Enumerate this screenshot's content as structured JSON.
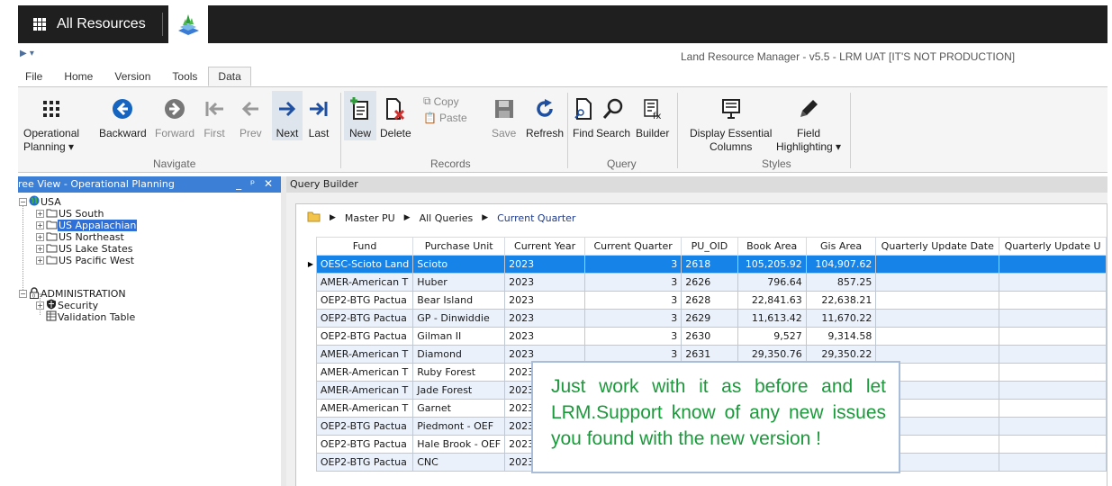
{
  "topbar": {
    "waffle_icon": "app-launcher-icon",
    "title": "All Resources",
    "logo_icon": "lrm-logo-icon"
  },
  "window": {
    "title": "Land Resource Manager - v5.5 - LRM UAT [IT'S NOT PRODUCTION]"
  },
  "menu": {
    "tabs": [
      "File",
      "Home",
      "Version",
      "Tools",
      "Data"
    ],
    "active": "Data"
  },
  "ribbon": {
    "operational_planning": [
      "Operational",
      "Planning ▾"
    ],
    "backward": "Backward",
    "forward": "Forward",
    "first": "First",
    "prev": "Prev",
    "next": "Next",
    "last": "Last",
    "navigate_group": "Navigate",
    "new": "New",
    "delete": "Delete",
    "copy": "Copy",
    "paste": "Paste",
    "save": "Save",
    "refresh": "Refresh",
    "records_group": "Records",
    "find": "Find",
    "search": "Search",
    "builder": "Builder",
    "query_group": "Query",
    "display_essential": [
      "Display Essential",
      "Columns"
    ],
    "field_highlighting": [
      "Field",
      "Highlighting ▾"
    ],
    "styles_group": "Styles"
  },
  "tree": {
    "header": "ree View - Operational Planning",
    "header_controls": "_ ᵖ ✕",
    "nodes": {
      "usa": "USA",
      "us_south": "US South",
      "us_appalachian": "US Appalachian",
      "us_northeast": "US Northeast",
      "us_lake_states": "US Lake States",
      "us_pacific_west": "US Pacific West",
      "administration": "ADMINISTRATION",
      "security": "Security",
      "validation_table": "Validation Table"
    }
  },
  "query": {
    "header": "Query Builder",
    "breadcrumb": [
      "Master PU",
      "All Queries",
      "Current Quarter"
    ],
    "columns": [
      "Fund",
      "Purchase Unit",
      "Current Year",
      "Current Quarter",
      "PU_OID",
      "Book Area",
      "Gis Area",
      "Quarterly Update Date",
      "Quarterly Update U"
    ],
    "rows": [
      [
        "OESC-Scioto Land",
        "Scioto",
        "2023",
        "3",
        "2618",
        "105,205.92",
        "104,907.62",
        "",
        ""
      ],
      [
        "AMER-American T",
        "Huber",
        "2023",
        "3",
        "2626",
        "796.64",
        "857.25",
        "",
        ""
      ],
      [
        "OEP2-BTG Pactua",
        "Bear Island",
        "2023",
        "3",
        "2628",
        "22,841.63",
        "22,638.21",
        "",
        ""
      ],
      [
        "OEP2-BTG Pactua",
        "GP - Dinwiddie",
        "2023",
        "3",
        "2629",
        "11,613.42",
        "11,670.22",
        "",
        ""
      ],
      [
        "OEP2-BTG Pactua",
        "Gilman II",
        "2023",
        "3",
        "2630",
        "9,527",
        "9,314.58",
        "",
        ""
      ],
      [
        "AMER-American T",
        "Diamond",
        "2023",
        "3",
        "2631",
        "29,350.76",
        "29,350.22",
        "",
        ""
      ],
      [
        "AMER-American T",
        "Ruby Forest",
        "2023",
        "",
        "",
        "",
        "",
        "",
        ""
      ],
      [
        "AMER-American T",
        "Jade Forest",
        "2023",
        "",
        "",
        "",
        "",
        "",
        ""
      ],
      [
        "AMER-American T",
        "Garnet",
        "2023",
        "",
        "",
        "",
        "",
        "",
        ""
      ],
      [
        "OEP2-BTG Pactua",
        "Piedmont - OEF",
        "2023",
        "",
        "",
        "",
        "",
        "",
        ""
      ],
      [
        "OEP2-BTG Pactua",
        "Hale Brook - OEF",
        "2023",
        "",
        "",
        "",
        "",
        "",
        ""
      ],
      [
        "OEP2-BTG Pactua",
        "CNC",
        "2023",
        "",
        "",
        "",
        "",
        "",
        ""
      ]
    ],
    "selected_row": 0
  },
  "callout": {
    "text": "Just work with it as before and let LRM.Support know of any new issues you found with the new version !"
  },
  "colors": {
    "selection": "#1683e8",
    "tree_header": "#3c7fd6",
    "callout_text": "#1a9a3a"
  }
}
